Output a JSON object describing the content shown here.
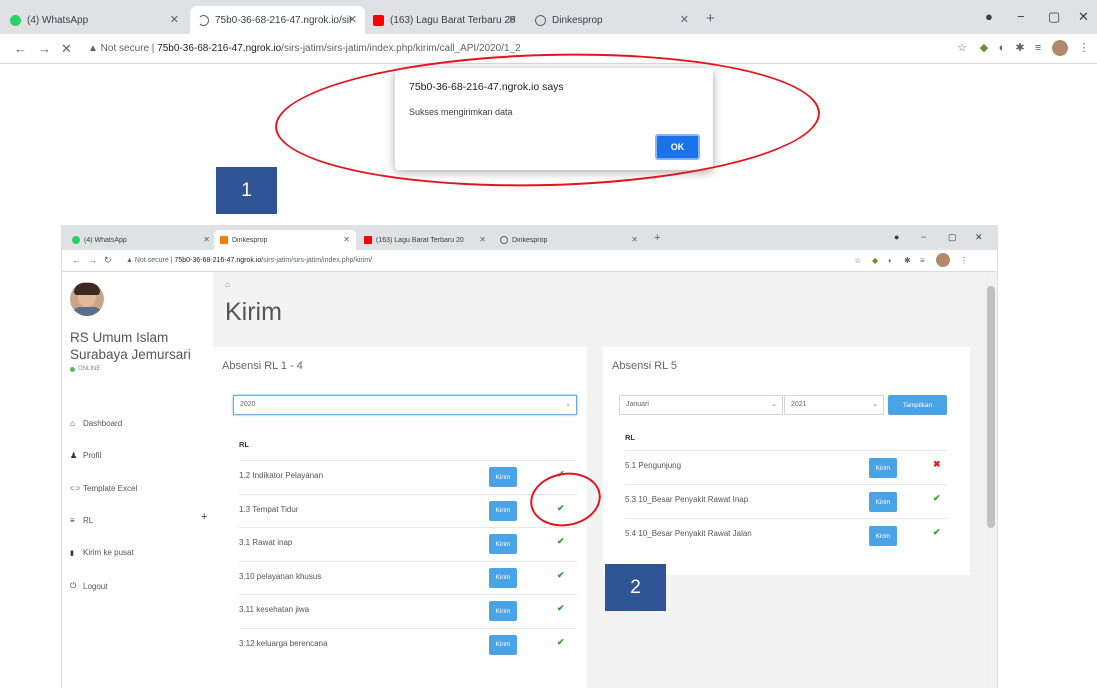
{
  "browser": {
    "tabs": [
      {
        "label": "(4) WhatsApp",
        "favicon_color": "#25d366"
      },
      {
        "label": "75b0-36-68-216-47.ngrok.io/sir",
        "favicon_color": "#5f6368"
      },
      {
        "label": "(163) Lagu Barat Terbaru 20",
        "favicon_color": "#ff0000"
      },
      {
        "label": "Dinkesprop",
        "favicon_color": "#5f6368"
      }
    ],
    "new_tab": "+",
    "address": {
      "security": "▲ Not secure |",
      "host": "75b0-36-68-216-47.ngrok.io",
      "path": "/sirs-jatim/sirs-jatim/index.php/kirim/call_API/2020/1_2"
    }
  },
  "alert": {
    "title": "75b0-36-68-216-47.ngrok.io says",
    "message": "Sukses mengirimkan data",
    "ok_label": "OK"
  },
  "markers": {
    "one": "1",
    "two": "2"
  },
  "inner_browser": {
    "tabs": [
      {
        "label": "(4) WhatsApp",
        "favicon_color": "#25d366"
      },
      {
        "label": "Dinkesprop",
        "favicon_color": "#f57c00"
      },
      {
        "label": "(163) Lagu Barat Terbaru 20",
        "favicon_color": "#ff0000"
      },
      {
        "label": "Dinkesprop",
        "favicon_color": "#5f6368"
      }
    ],
    "new_tab": "+",
    "address": {
      "security": "▲ Not secure |",
      "host": "75b0-36-68-216-47.ngrok.io",
      "path": "/sirs-jatim/sirs-jatim/index.php/kirim/"
    }
  },
  "sidebar": {
    "hospital_line1": "RS Umum Islam",
    "hospital_line2": "Surabaya Jemursari",
    "status": "ONLINE",
    "status_color": "#5cb85c",
    "items": [
      {
        "icon": "home-icon",
        "glyph": "⌂",
        "label": "Dashboard"
      },
      {
        "icon": "user-icon",
        "glyph": "♟",
        "label": "Profil"
      },
      {
        "icon": "copy-icon",
        "glyph": "⊂⊃",
        "label": "Template Excel"
      },
      {
        "icon": "list-icon",
        "glyph": "≡",
        "label": "RL"
      },
      {
        "icon": "file-icon",
        "glyph": "▮",
        "label": "Kirim ke pusat"
      },
      {
        "icon": "power-icon",
        "glyph": "⏻",
        "label": "Logout"
      }
    ],
    "rl_expand": "+"
  },
  "main": {
    "breadcrumb_icon": "home-icon",
    "breadcrumb_glyph": "⌂",
    "title": "Kirim",
    "absensi_rl14": {
      "title": "Absensi RL 1 - 4",
      "year": "2020",
      "header": "RL",
      "button_label": "Kirim",
      "rows": [
        {
          "name": "1.2 Indikator Pelayanan",
          "status": "ok"
        },
        {
          "name": "1.3 Tempat Tidur",
          "status": "ok"
        },
        {
          "name": "3.1 Rawat inap",
          "status": "ok"
        },
        {
          "name": "3.10 pelayanan khusus",
          "status": "ok"
        },
        {
          "name": "3.11 kesehatan jiwa",
          "status": "ok"
        },
        {
          "name": "3.12 keluarga berencana",
          "status": "ok"
        }
      ]
    },
    "absensi_rl5": {
      "title": "Absensi RL 5",
      "month": "Januari",
      "year": "2021",
      "show_label": "Tampilkan",
      "header": "RL",
      "button_label": "Kirim",
      "rows": [
        {
          "name": "5.1 Pengunjung",
          "status": "no"
        },
        {
          "name": "5.3 10_Besar Penyakit Rawat Inap",
          "status": "ok"
        },
        {
          "name": "5.4 10_Besar Penyakit Rawat Jalan",
          "status": "ok"
        }
      ]
    }
  },
  "status_glyphs": {
    "ok": "✔",
    "no": "✖"
  },
  "colors": {
    "accent": "#3c8dbc",
    "button": "#4aa3e6",
    "ok": "#2e9e2e",
    "error": "#d9231f",
    "annotation": "#e3141b",
    "marker": "#2f5597"
  }
}
